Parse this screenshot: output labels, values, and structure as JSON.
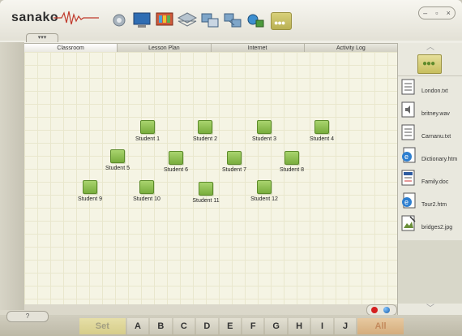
{
  "app": {
    "logo": "sanako",
    "window_controls": {
      "minimize": "–",
      "restore": "▫",
      "close": "×"
    },
    "collapse_label": "▾▾▾"
  },
  "toolbar": {
    "icons": [
      "network-icon",
      "monitor-icon",
      "display-icon",
      "layers-icon",
      "screen-transfer-icon",
      "broadcast-icon",
      "group-icon"
    ],
    "more_label": "●●●"
  },
  "tabs": [
    {
      "label": "Classroom",
      "active": true
    },
    {
      "label": "Lesson Plan",
      "active": false
    },
    {
      "label": "Internet",
      "active": false
    },
    {
      "label": "Activity Log",
      "active": false
    }
  ],
  "students": [
    {
      "label": "Student 1"
    },
    {
      "label": "Student 2"
    },
    {
      "label": "Student 3"
    },
    {
      "label": "Student 4"
    },
    {
      "label": "Student 5"
    },
    {
      "label": "Student 6"
    },
    {
      "label": "Student 7"
    },
    {
      "label": "Student 8"
    },
    {
      "label": "Student 9"
    },
    {
      "label": "Student 10"
    },
    {
      "label": "Student 11"
    },
    {
      "label": "Student 12"
    }
  ],
  "files": [
    {
      "name": "London.txt",
      "icon": "text-file-icon"
    },
    {
      "name": "britney.wav",
      "icon": "audio-file-icon"
    },
    {
      "name": "Carnanu.txt",
      "icon": "text-file-icon"
    },
    {
      "name": "Dictionary.htm",
      "icon": "web-file-icon"
    },
    {
      "name": "Family.doc",
      "icon": "doc-file-icon"
    },
    {
      "name": "Tour2.htm",
      "icon": "web-file-icon"
    },
    {
      "name": "bridges2.jpg",
      "icon": "image-file-icon"
    }
  ],
  "bottom": {
    "help_label": "?",
    "set_label": "Set",
    "letters": [
      "A",
      "B",
      "C",
      "D",
      "E",
      "F",
      "G",
      "H",
      "I",
      "J"
    ],
    "all_label": "All"
  },
  "colors": {
    "student_monitor": "#8ec24e",
    "accent_more": "#c8bf5e",
    "record": "#d42020"
  }
}
